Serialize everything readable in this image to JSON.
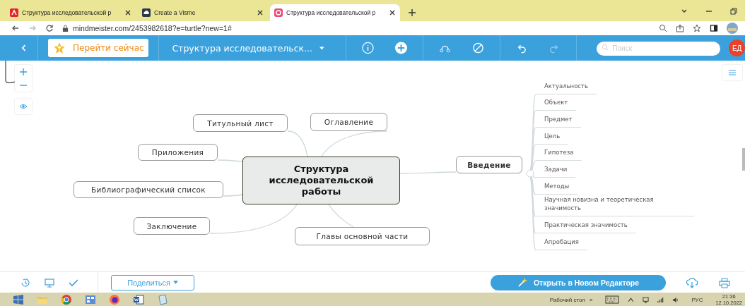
{
  "browser": {
    "tabs": [
      {
        "title": "Структура исследовательской р",
        "selected": false
      },
      {
        "title": "Create a Visme",
        "selected": false
      },
      {
        "title": "Структура исследовательской р",
        "selected": true
      }
    ],
    "url": "mindmeister.com/2453982618?e=turtle?new=1#"
  },
  "toolbar": {
    "go_button": "Перейти сейчас",
    "map_title": "Структура исследовательск...",
    "search": {
      "placeholder": "Поиск"
    },
    "avatar": "ЕД"
  },
  "mindmap": {
    "central": "Структура исследовательской работы",
    "topics": [
      {
        "label": "Оглавление"
      },
      {
        "label": "Титульный лист"
      },
      {
        "label": "Приложения"
      },
      {
        "label": "Введение",
        "children": [
          "Актуальность",
          "Объект",
          "Предмет",
          "Цель",
          "Гипотеза",
          "Задачи",
          "Методы",
          "Научная новизна и теоретическая значимость",
          "Практическая значимость",
          "Апробация"
        ]
      },
      {
        "label": "Библиографический список"
      },
      {
        "label": "Заключение"
      },
      {
        "label": "Главы основной части"
      }
    ]
  },
  "bottom_bar": {
    "share_button": "Поделиться",
    "open_button": "Открыть в Новом Редакторе"
  },
  "taskbar": {
    "desktop_label": "Рабочий стол",
    "overflow": "»",
    "language": "РУС",
    "time": "21:36",
    "date": "12.10.2022"
  }
}
